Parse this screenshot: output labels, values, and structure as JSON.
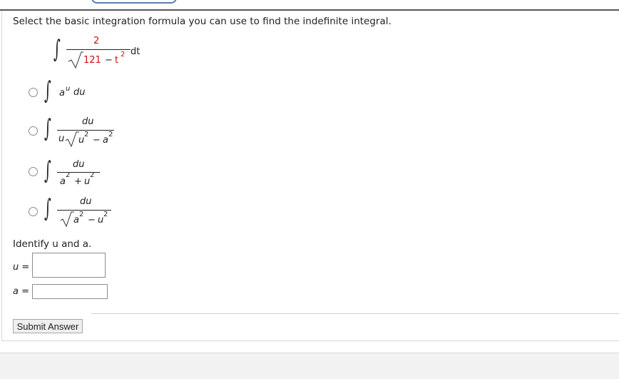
{
  "question": {
    "prompt": "Select the basic integration formula you can use to find the indefinite integral.",
    "integral": {
      "numerator": "2",
      "radicand_a": "121",
      "minus": "−",
      "radicand_b": "t",
      "exp": "2",
      "differential": "dt"
    }
  },
  "options": [
    {
      "expr_main": "a",
      "expr_sup": "u",
      "expr_tail": "du"
    },
    {
      "numerator": "du",
      "den_pre": "u",
      "den_a": "u",
      "den_a_exp": "2",
      "den_op": "−",
      "den_b": "a",
      "den_b_exp": "2"
    },
    {
      "numerator": "du",
      "den_a": "a",
      "den_a_exp": "2",
      "den_op": "+",
      "den_b": "u",
      "den_b_exp": "2"
    },
    {
      "numerator": "du",
      "den_a": "a",
      "den_a_exp": "2",
      "den_op": "−",
      "den_b": "u",
      "den_b_exp": "2"
    }
  ],
  "identify": {
    "prompt": "Identify u and a.",
    "u_label": "u =",
    "a_label": "a =",
    "u_value": "",
    "a_value": ""
  },
  "submit_label": "Submit Answer"
}
